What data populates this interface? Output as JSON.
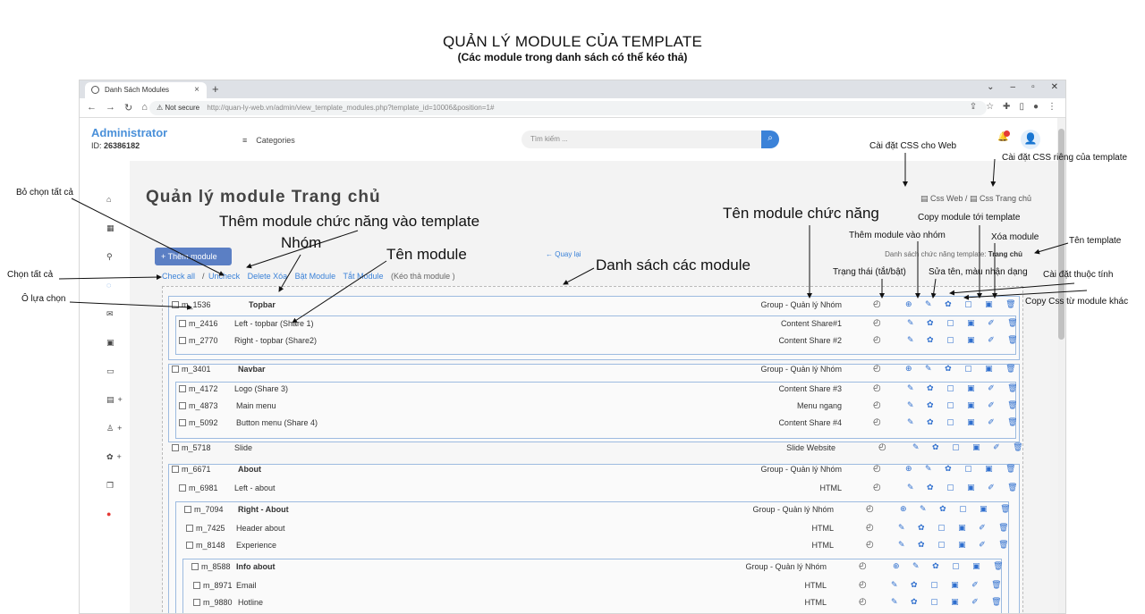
{
  "doc": {
    "title": "QUẢN LÝ MODULE CỦA TEMPLATE",
    "subtitle": "(Các module trong danh sách có thể kéo thả)"
  },
  "browser": {
    "tab_title": "Danh Sách Modules",
    "not_secure": "Not secure",
    "url": "http://quan-ly-web.vn/admin/view_template_modules.php?template_id=10006&position=1#"
  },
  "header": {
    "admin_name": "Administrator",
    "id_label": "ID:",
    "id_value": "26386182",
    "categories": "Categories",
    "search_placeholder": "Tìm kiếm ..."
  },
  "main": {
    "page_title": "Quản lý module Trang chủ",
    "css_web": "Css Web",
    "css_sep": "/",
    "css_home": "Css Trang chủ",
    "add_module": "+ Thêm module",
    "back": "← Quay lại",
    "template_label": "Danh sách chức năng template:",
    "template_name": "Trang chủ",
    "check_all": "Check all",
    "slash": "/",
    "uncheck": "Uncheck",
    "delete": "Delete Xóa",
    "enable": "Bật Module",
    "disable": "Tắt Module",
    "drag_note": "(Kéo thả module )"
  },
  "rows": [
    {
      "id": "m_1536",
      "name": "Topbar",
      "type": "Group - Quản lý Nhóm",
      "group": true
    },
    {
      "id": "m_2416",
      "name": "Left - topbar (Share 1)",
      "type": "Content Share#1",
      "group": false
    },
    {
      "id": "m_2770",
      "name": "Right - topbar (Share2)",
      "type": "Content Share #2",
      "group": false
    },
    {
      "id": "m_3401",
      "name": "Navbar",
      "type": "Group - Quản lý Nhóm",
      "group": true
    },
    {
      "id": "m_4172",
      "name": "Logo (Share 3)",
      "type": "Content Share #3",
      "group": false
    },
    {
      "id": "m_4873",
      "name": "Main menu",
      "type": "Menu ngang",
      "group": false
    },
    {
      "id": "m_5092",
      "name": "Button menu (Share 4)",
      "type": "Content Share #4",
      "group": false
    },
    {
      "id": "m_5718",
      "name": "Slide",
      "type": "Slide Website",
      "group": false
    },
    {
      "id": "m_6671",
      "name": "About",
      "type": "Group - Quản lý Nhóm",
      "group": true
    },
    {
      "id": "m_6981",
      "name": "Left - about",
      "type": "HTML",
      "group": false
    },
    {
      "id": "m_7094",
      "name": "Right - About",
      "type": "Group - Quản lý Nhóm",
      "group": true
    },
    {
      "id": "m_7425",
      "name": "Header about",
      "type": "HTML",
      "group": false
    },
    {
      "id": "m_8148",
      "name": "Experience",
      "type": "HTML",
      "group": false
    },
    {
      "id": "m_8588",
      "name": "Info about",
      "type": "Group - Quản lý Nhóm",
      "group": true
    },
    {
      "id": "m_8971",
      "name": "Email",
      "type": "HTML",
      "group": false
    },
    {
      "id": "m_9880",
      "name": "Hotline",
      "type": "HTML",
      "group": false
    }
  ],
  "icons": {
    "status": "◴",
    "group_set": "⊕ ✎ ✿ ▢ ▣ 🗑",
    "item_set": "✎ ✿ ▢ ▣ ✐ 🗑"
  },
  "annotations": {
    "bo_chon": "Bỏ chọn tất cả",
    "them_module": "Thêm module chức năng vào template",
    "nhom": "Nhóm",
    "ten_module": "Tên module",
    "chon_tat_ca": "Chọn tất cả",
    "o_lua_chon": "Ô lựa chọn",
    "danh_sach": "Danh sách các module",
    "ten_chuc_nang": "Tên module chức năng",
    "trang_thai": "Trạng thái (tắt/bật)",
    "them_vao_nhom": "Thêm module vào nhóm",
    "sua_ten": "Sửa tên, màu nhận dạng",
    "copy_template": "Copy module tới template",
    "xoa_module": "Xóa module",
    "ten_template": "Tên template",
    "cai_dat_thuoc_tinh": "Cài đặt thuộc tính",
    "copy_css": "Copy Css từ module khác",
    "css_web": "Cài đặt CSS cho Web",
    "css_rieng": "Cài đặt CSS riêng của template"
  },
  "colors": {
    "accent": "#3b82d8",
    "button": "#5b7fc4",
    "group_border": "#9dbbe0"
  }
}
